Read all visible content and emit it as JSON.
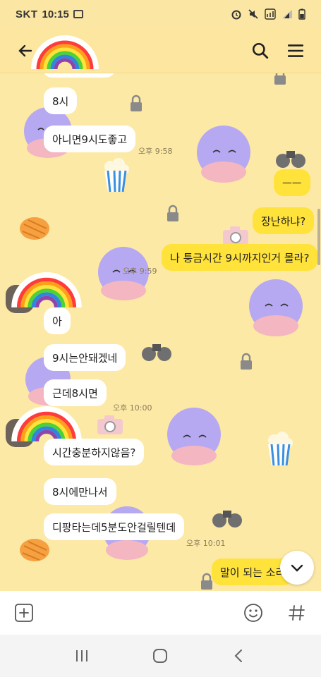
{
  "status": {
    "carrier": "SKT",
    "time": "10:15"
  },
  "messages": [
    {
      "side": "in",
      "text": "8시"
    },
    {
      "side": "in",
      "text": "아니면9시도좋고",
      "time": "오후 9:58"
    },
    {
      "side": "out",
      "text": "ㅡㅡ"
    },
    {
      "side": "out",
      "text": "장난하냐?"
    },
    {
      "side": "out",
      "text": "나 퉁금시간 9시까지인거 몰라?",
      "time": "오후 9:59"
    },
    {
      "side": "in",
      "text": "아"
    },
    {
      "side": "in",
      "text": "9시는안돼겠네"
    },
    {
      "side": "in",
      "text": "근데8시면",
      "time": "오후 10:00"
    },
    {
      "side": "in",
      "text": "시간충분하지않음?"
    },
    {
      "side": "in",
      "text": "8시에만나서"
    },
    {
      "side": "in",
      "text": "디팡타는데5분도안걸릴텐데",
      "time": "오후 10:01"
    },
    {
      "side": "out",
      "text": "말이 되는 소리"
    }
  ],
  "icons": {
    "back": "arrow-left-icon",
    "search": "search-icon",
    "menu": "menu-icon",
    "attach": "plus-square-icon",
    "emoji": "emoji-icon",
    "hash": "hash-icon",
    "scroll_down": "chevron-down-icon"
  },
  "colors": {
    "background": "#fde9a6",
    "my_bubble": "#ffe23a",
    "their_bubble": "#ffffff"
  }
}
